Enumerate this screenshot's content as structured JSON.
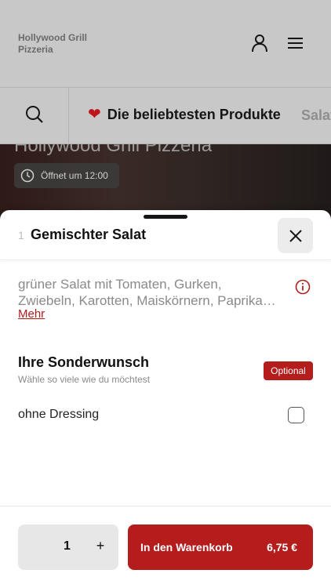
{
  "header": {
    "brand": "Hollywood Grill Pizzeria",
    "user_icon": "user-icon",
    "menu_icon": "menu-icon"
  },
  "categories": {
    "search_icon": "search-icon",
    "active_emoji": "❤️",
    "active_label": "Die beliebtesten Produkte",
    "next_label": "Salat"
  },
  "hero": {
    "title": "Hollywood Grill Pizzeria",
    "open_status": "Öffnet um 12:00"
  },
  "product": {
    "qty_prefix": "1",
    "title": "Gemischter Salat",
    "description_line1": "grüner Salat mit Tomaten, Gurken,",
    "description_line2": "Zwiebeln, Karotten, Maiskörnern, Paprika…",
    "more_label": "Mehr"
  },
  "options": {
    "section_title": "Ihre Sonderwunsch",
    "section_subtitle": "Wähle so viele wie du möchtest",
    "badge": "Optional",
    "items": [
      {
        "label": "ohne Dressing",
        "checked": false
      }
    ]
  },
  "footer": {
    "quantity": "1",
    "plus": "+",
    "cart_label": "In den Warenkorb",
    "price": "6,75 €"
  },
  "colors": {
    "accent": "#b51c1c",
    "header_bg": "#c8c8c8"
  }
}
